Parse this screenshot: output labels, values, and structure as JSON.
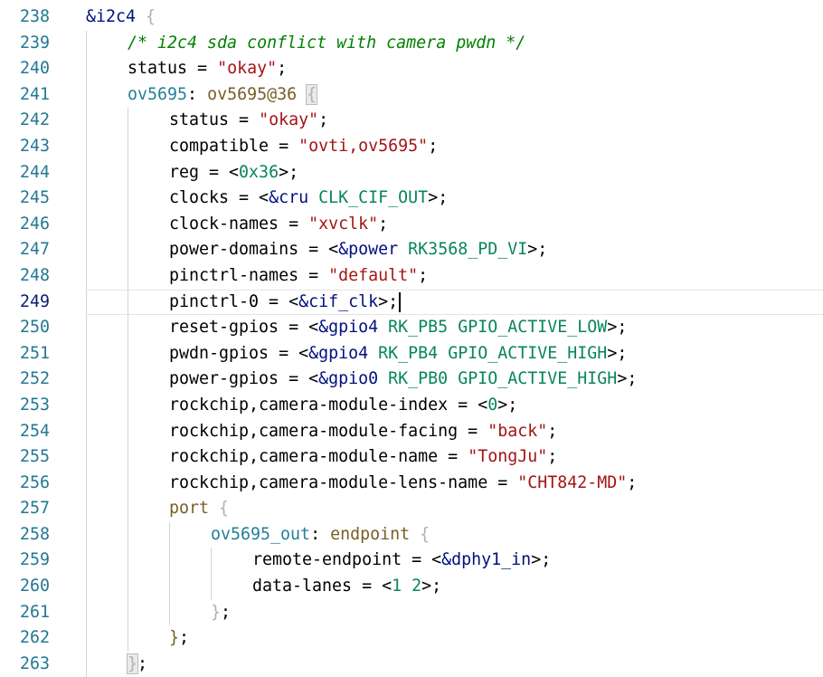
{
  "editor": {
    "current_line": 249,
    "lines": [
      {
        "n": "238",
        "indent": 0,
        "tokens": [
          {
            "t": "&i2c4 ",
            "c": "ref"
          },
          {
            "t": "{",
            "c": "brace"
          }
        ]
      },
      {
        "n": "239",
        "indent": 1,
        "tokens": [
          {
            "t": "/* i2c4 sda conflict with camera pwdn */",
            "c": "com"
          }
        ]
      },
      {
        "n": "240",
        "indent": 1,
        "tokens": [
          {
            "t": "status = ",
            "c": "plain"
          },
          {
            "t": "\"okay\"",
            "c": "str"
          },
          {
            "t": ";",
            "c": "plain"
          }
        ]
      },
      {
        "n": "241",
        "indent": 1,
        "tokens": [
          {
            "t": "ov5695",
            "c": "node"
          },
          {
            "t": ": ",
            "c": "plain"
          },
          {
            "t": "ov5695@36",
            "c": "kw"
          },
          {
            "t": " ",
            "c": "plain"
          },
          {
            "t": "{",
            "c": "brace-hl"
          }
        ]
      },
      {
        "n": "242",
        "indent": 2,
        "tokens": [
          {
            "t": "status = ",
            "c": "plain"
          },
          {
            "t": "\"okay\"",
            "c": "str"
          },
          {
            "t": ";",
            "c": "plain"
          }
        ]
      },
      {
        "n": "243",
        "indent": 2,
        "tokens": [
          {
            "t": "compatible = ",
            "c": "plain"
          },
          {
            "t": "\"ovti,ov5695\"",
            "c": "str"
          },
          {
            "t": ";",
            "c": "plain"
          }
        ]
      },
      {
        "n": "244",
        "indent": 2,
        "tokens": [
          {
            "t": "reg = <",
            "c": "plain"
          },
          {
            "t": "0x36",
            "c": "num"
          },
          {
            "t": ">;",
            "c": "plain"
          }
        ]
      },
      {
        "n": "245",
        "indent": 2,
        "tokens": [
          {
            "t": "clocks = <",
            "c": "plain"
          },
          {
            "t": "&cru",
            "c": "ref"
          },
          {
            "t": " ",
            "c": "plain"
          },
          {
            "t": "CLK_CIF_OUT",
            "c": "macro"
          },
          {
            "t": ">;",
            "c": "plain"
          }
        ]
      },
      {
        "n": "246",
        "indent": 2,
        "tokens": [
          {
            "t": "clock-names = ",
            "c": "plain"
          },
          {
            "t": "\"xvclk\"",
            "c": "str"
          },
          {
            "t": ";",
            "c": "plain"
          }
        ]
      },
      {
        "n": "247",
        "indent": 2,
        "tokens": [
          {
            "t": "power-domains = <",
            "c": "plain"
          },
          {
            "t": "&power",
            "c": "ref"
          },
          {
            "t": " ",
            "c": "plain"
          },
          {
            "t": "RK3568_PD_VI",
            "c": "macro"
          },
          {
            "t": ">;",
            "c": "plain"
          }
        ]
      },
      {
        "n": "248",
        "indent": 2,
        "tokens": [
          {
            "t": "pinctrl-names = ",
            "c": "plain"
          },
          {
            "t": "\"default\"",
            "c": "str"
          },
          {
            "t": ";",
            "c": "plain"
          }
        ]
      },
      {
        "n": "249",
        "indent": 2,
        "tokens": [
          {
            "t": "pinctrl-0 = <",
            "c": "plain"
          },
          {
            "t": "&cif_clk",
            "c": "ref"
          },
          {
            "t": ">;",
            "c": "plain"
          }
        ]
      },
      {
        "n": "250",
        "indent": 2,
        "tokens": [
          {
            "t": "reset-gpios = <",
            "c": "plain"
          },
          {
            "t": "&gpio4",
            "c": "ref"
          },
          {
            "t": " ",
            "c": "plain"
          },
          {
            "t": "RK_PB5",
            "c": "macro"
          },
          {
            "t": " ",
            "c": "plain"
          },
          {
            "t": "GPIO_ACTIVE_LOW",
            "c": "macro"
          },
          {
            "t": ">;",
            "c": "plain"
          }
        ]
      },
      {
        "n": "251",
        "indent": 2,
        "tokens": [
          {
            "t": "pwdn-gpios = <",
            "c": "plain"
          },
          {
            "t": "&gpio4",
            "c": "ref"
          },
          {
            "t": " ",
            "c": "plain"
          },
          {
            "t": "RK_PB4",
            "c": "macro"
          },
          {
            "t": " ",
            "c": "plain"
          },
          {
            "t": "GPIO_ACTIVE_HIGH",
            "c": "macro"
          },
          {
            "t": ">;",
            "c": "plain"
          }
        ]
      },
      {
        "n": "252",
        "indent": 2,
        "tokens": [
          {
            "t": "power-gpios = <",
            "c": "plain"
          },
          {
            "t": "&gpio0",
            "c": "ref"
          },
          {
            "t": " ",
            "c": "plain"
          },
          {
            "t": "RK_PB0",
            "c": "macro"
          },
          {
            "t": " ",
            "c": "plain"
          },
          {
            "t": "GPIO_ACTIVE_HIGH",
            "c": "macro"
          },
          {
            "t": ">;",
            "c": "plain"
          }
        ]
      },
      {
        "n": "253",
        "indent": 2,
        "tokens": [
          {
            "t": "rockchip,camera-module-index = <",
            "c": "plain"
          },
          {
            "t": "0",
            "c": "num"
          },
          {
            "t": ">;",
            "c": "plain"
          }
        ]
      },
      {
        "n": "254",
        "indent": 2,
        "tokens": [
          {
            "t": "rockchip,camera-module-facing = ",
            "c": "plain"
          },
          {
            "t": "\"back\"",
            "c": "str"
          },
          {
            "t": ";",
            "c": "plain"
          }
        ]
      },
      {
        "n": "255",
        "indent": 2,
        "tokens": [
          {
            "t": "rockchip,camera-module-name = ",
            "c": "plain"
          },
          {
            "t": "\"TongJu\"",
            "c": "str"
          },
          {
            "t": ";",
            "c": "plain"
          }
        ]
      },
      {
        "n": "256",
        "indent": 2,
        "tokens": [
          {
            "t": "rockchip,camera-module-lens-name = ",
            "c": "plain"
          },
          {
            "t": "\"CHT842-MD\"",
            "c": "str"
          },
          {
            "t": ";",
            "c": "plain"
          }
        ]
      },
      {
        "n": "257",
        "indent": 2,
        "tokens": [
          {
            "t": "port",
            "c": "kw"
          },
          {
            "t": " ",
            "c": "plain"
          },
          {
            "t": "{",
            "c": "brace"
          }
        ]
      },
      {
        "n": "258",
        "indent": 3,
        "tokens": [
          {
            "t": "ov5695_out",
            "c": "node"
          },
          {
            "t": ": ",
            "c": "plain"
          },
          {
            "t": "endpoint",
            "c": "kw"
          },
          {
            "t": " ",
            "c": "plain"
          },
          {
            "t": "{",
            "c": "brace"
          }
        ]
      },
      {
        "n": "259",
        "indent": 4,
        "tokens": [
          {
            "t": "remote-endpoint = <",
            "c": "plain"
          },
          {
            "t": "&dphy1_in",
            "c": "ref"
          },
          {
            "t": ">;",
            "c": "plain"
          }
        ]
      },
      {
        "n": "260",
        "indent": 4,
        "tokens": [
          {
            "t": "data-lanes = <",
            "c": "plain"
          },
          {
            "t": "1",
            "c": "num"
          },
          {
            "t": " ",
            "c": "plain"
          },
          {
            "t": "2",
            "c": "num"
          },
          {
            "t": ">;",
            "c": "plain"
          }
        ]
      },
      {
        "n": "261",
        "indent": 3,
        "tokens": [
          {
            "t": "}",
            "c": "brace"
          },
          {
            "t": ";",
            "c": "plain"
          }
        ]
      },
      {
        "n": "262",
        "indent": 2,
        "tokens": [
          {
            "t": "}",
            "c": "kw"
          },
          {
            "t": ";",
            "c": "plain"
          }
        ]
      },
      {
        "n": "263",
        "indent": 1,
        "tokens": [
          {
            "t": "}",
            "c": "brace-hl"
          },
          {
            "t": ";",
            "c": "plain"
          }
        ]
      }
    ]
  }
}
